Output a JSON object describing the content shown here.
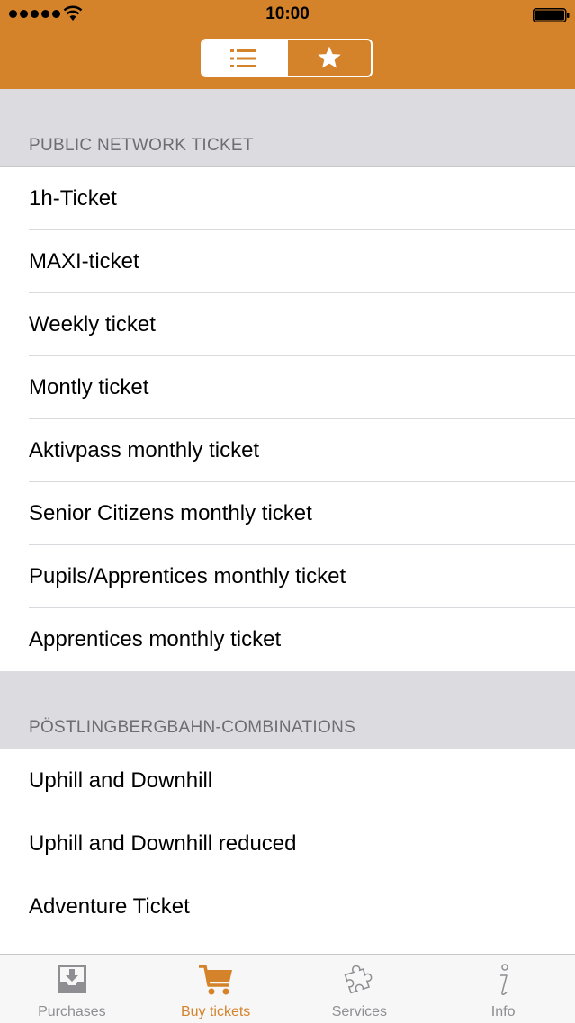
{
  "status_bar": {
    "time": "10:00"
  },
  "segmented_control": {
    "segments": [
      {
        "icon": "list-icon",
        "selected": true
      },
      {
        "icon": "star-icon",
        "selected": false
      }
    ]
  },
  "sections": [
    {
      "title": "PUBLIC NETWORK TICKET",
      "items": [
        "1h-Ticket",
        "MAXI-ticket",
        "Weekly ticket",
        "Montly ticket",
        "Aktivpass monthly ticket",
        "Senior Citizens monthly ticket",
        "Pupils/Apprentices monthly ticket",
        "Apprentices monthly ticket"
      ]
    },
    {
      "title": "PÖSTLINGBERGBAHN-COMBINATIONS",
      "items": [
        "Uphill and Downhill",
        "Uphill and Downhill reduced",
        "Adventure Ticket"
      ]
    }
  ],
  "tab_bar": {
    "tabs": [
      {
        "label": "Purchases",
        "icon": "purchases-tray-icon",
        "active": false
      },
      {
        "label": "Buy tickets",
        "icon": "cart-icon",
        "active": true
      },
      {
        "label": "Services",
        "icon": "puzzle-icon",
        "active": false
      },
      {
        "label": "Info",
        "icon": "info-icon",
        "active": false
      }
    ]
  },
  "colors": {
    "accent": "#d4832a",
    "background": "#dcdce0",
    "inactive": "#8e8e93"
  }
}
